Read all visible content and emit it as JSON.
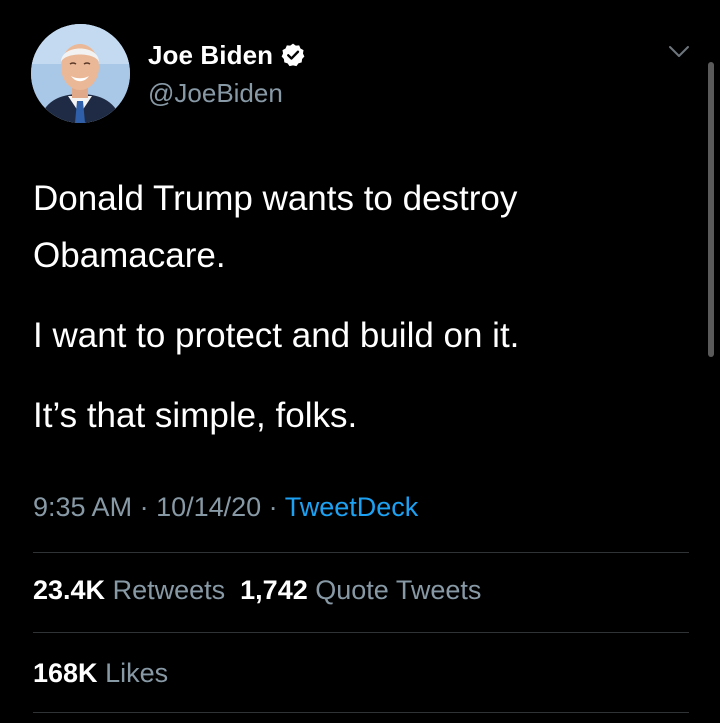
{
  "author": {
    "display_name": "Joe Biden",
    "handle": "@JoeBiden",
    "verified": true
  },
  "tweet": {
    "paragraphs": [
      "Donald Trump wants to destroy Obamacare.",
      "I want to protect and build on it.",
      "It’s that simple, folks."
    ]
  },
  "meta": {
    "time": "9:35 AM",
    "sep1": " · ",
    "date": "10/14/20",
    "sep2": " · ",
    "source": "TweetDeck"
  },
  "stats": {
    "retweets_count": "23.4K",
    "retweets_label": "Retweets",
    "quote_count": "1,742",
    "quote_label": "Quote Tweets",
    "likes_count": "168K",
    "likes_label": "Likes"
  },
  "icons": {
    "verified": "verified-badge-icon",
    "menu": "chevron-down-icon"
  },
  "colors": {
    "background": "#000000",
    "primary_text": "#ffffff",
    "secondary_text": "#8899a6",
    "link": "#1da1f2",
    "divider": "#2f3336"
  }
}
